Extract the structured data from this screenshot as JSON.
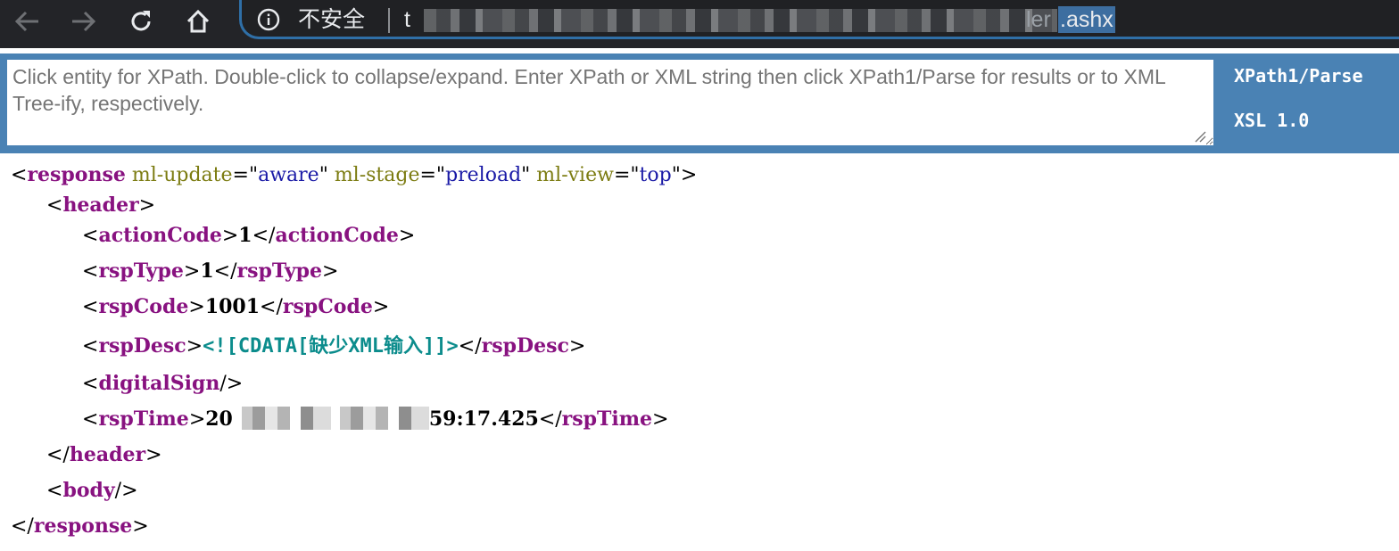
{
  "browser": {
    "security_label": "不安全",
    "url_prefix": "t",
    "url_fade": "ler",
    "url_suffix": ".ashx",
    "icons": [
      "back-arrow-icon",
      "forward-arrow-icon",
      "reload-icon",
      "home-icon",
      "info-icon"
    ]
  },
  "xpath_panel": {
    "placeholder": "Click entity for XPath. Double-click to collapse/expand. Enter XPath or XML string then click XPath1/Parse for results or to XML Tree-ify, respectively.",
    "value": "",
    "button_parse": "XPath1/Parse",
    "button_xsl": "XSL 1.0"
  },
  "xml": {
    "root_tag": "response",
    "root_attrs": [
      {
        "name": "ml-update",
        "value": "aware"
      },
      {
        "name": "ml-stage",
        "value": "preload"
      },
      {
        "name": "ml-view",
        "value": "top"
      }
    ],
    "header_tag": "header",
    "children": [
      {
        "tag": "actionCode",
        "value": "1"
      },
      {
        "tag": "rspType",
        "value": "1"
      },
      {
        "tag": "rspCode",
        "value": "1001"
      },
      {
        "tag": "rspDesc",
        "cdata": "<![CDATA[缺少XML输入]]>"
      },
      {
        "tag": "digitalSign",
        "self_closing": true
      },
      {
        "tag": "rspTime",
        "value_prefix": "20",
        "value_suffix": "59:17.425"
      }
    ],
    "body_tag": "body"
  }
}
